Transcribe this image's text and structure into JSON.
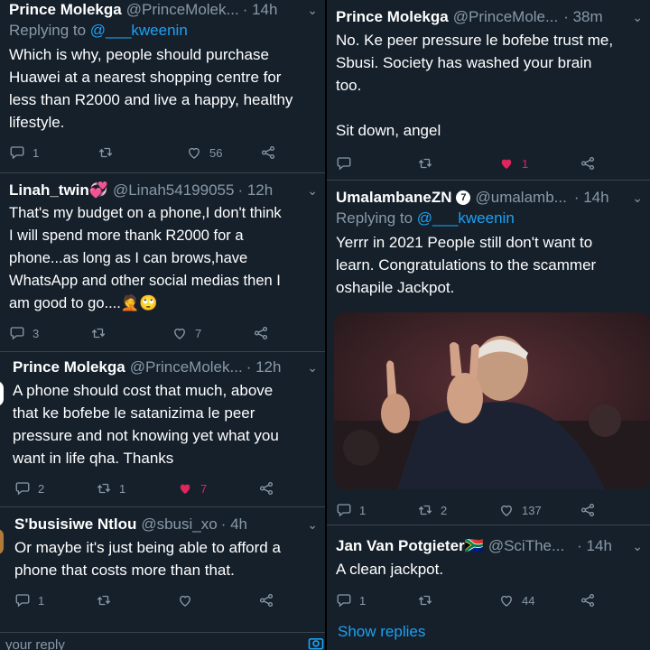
{
  "left": {
    "tweet1": {
      "name": "Prince Molekga",
      "handle": "@PrinceMolek...",
      "time": "· 14h",
      "replying_prefix": "Replying to ",
      "replying_handle": "@___kweenin",
      "lines": [
        "Which is why, people should purchase",
        "Huawei at a nearest shopping centre for",
        "less than R2000 and live a happy, healthy",
        "lifestyle."
      ],
      "replies": "1",
      "retweets": "",
      "likes": "56"
    },
    "tweet2": {
      "name": "Linah_twin💞",
      "handle": "@Linah54199055",
      "time": "· 12h",
      "lines": [
        "That's my budget on a phone,I don't think",
        "I will spend more thank R2000 for a",
        "phone...as long as I can brows,have",
        "WhatsApp and other social medias then I",
        "am good to go....🤦🙄"
      ],
      "replies": "3",
      "retweets": "",
      "likes": "7"
    },
    "tweet3": {
      "name": "Prince Molekga",
      "handle": "@PrinceMolek...",
      "time": "· 12h",
      "lines": [
        "A phone should cost that much, above",
        "that ke bofebe le satanizima le peer",
        "pressure and not knowing yet what you",
        "want in life qha. Thanks"
      ],
      "replies": "2",
      "retweets": "1",
      "likes": "7"
    },
    "tweet4": {
      "name": "S'busisiwe Ntlou",
      "handle": "@sbusi_xo",
      "time": "· 4h",
      "lines": [
        "Or maybe it's just being able to afford a",
        "phone that costs more than that."
      ],
      "replies": "1",
      "retweets": "",
      "likes": ""
    },
    "compose_placeholder": "your reply"
  },
  "right": {
    "tweet1": {
      "name": "Prince Molekga",
      "handle": "@PrinceMole...",
      "time": "· 38m",
      "lines": [
        "No. Ke peer pressure le bofebe trust me,",
        "Sbusi. Society has washed your brain",
        "too.",
        "",
        "Sit down, angel"
      ],
      "replies": "",
      "retweets": "",
      "likes": "1"
    },
    "tweet2": {
      "name": "UmalambaneZN",
      "badge": "7",
      "handle": "@umalamb...",
      "time": "· 14h",
      "replying_prefix": "Replying to ",
      "replying_handle": "@___kweenin",
      "lines": [
        "Yerrr in 2021 People still don't want to",
        "learn. Congratulations to the scammer",
        "oshapile Jackpot."
      ],
      "replies": "1",
      "retweets": "2",
      "likes": "137"
    },
    "tweet3": {
      "name": "Jan Van Potgieter🇿🇦",
      "handle": "@SciThe...",
      "time": "· 14h",
      "lines": [
        "A clean jackpot."
      ],
      "replies": "1",
      "retweets": "",
      "likes": "44"
    },
    "show_replies": "Show replies"
  },
  "colors": {
    "background": "#15202b",
    "muted": "#8899a6",
    "link": "#1da1f2",
    "like": "#e0245e"
  }
}
